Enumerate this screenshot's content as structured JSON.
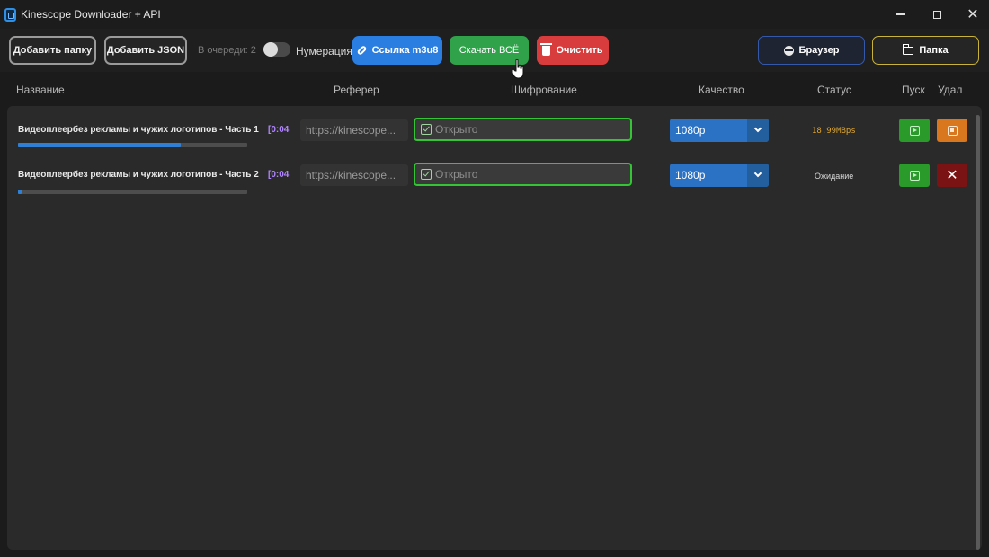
{
  "window": {
    "title": "Kinescope Downloader + API"
  },
  "toolbar": {
    "add_folder": "Добавить папку",
    "add_json": "Добавить JSON",
    "queue_label": "В очереди: 2",
    "numbering_label": "Нумерация",
    "numbering_on": false,
    "m3u8_link": "Ссылка m3u8",
    "download_all": "Скачать ВСЁ",
    "clear": "Очистить",
    "browser": "Браузер",
    "folder": "Папка"
  },
  "headers": {
    "name": "Название",
    "referer": "Реферер",
    "encryption": "Шифрование",
    "quality": "Качество",
    "status": "Статус",
    "start": "Пуск",
    "delete": "Удал"
  },
  "rows": [
    {
      "name": "Видеоплеербез рекламы и чужих логотипов - Часть 1",
      "duration": "[0:04",
      "progress": 0.71,
      "referer": "https://kinescope...",
      "encryption": "Открыто",
      "quality": "1080p",
      "status": "18.99MBps",
      "delete_action": "stop"
    },
    {
      "name": "Видеоплеербез рекламы и чужих логотипов - Часть 2",
      "duration": "[0:04",
      "progress": 0.01,
      "referer": "https://kinescope...",
      "encryption": "Открыто",
      "quality": "1080p",
      "status": "Ожидание",
      "delete_action": "remove"
    }
  ],
  "colors": {
    "accent_blue": "#2a7de1",
    "download_green": "#2fa24a",
    "clear_red": "#d93c3c",
    "encryption_border": "#35c435",
    "speed_status": "#e0a52c",
    "duration_purple": "#b084ff"
  },
  "icons": {
    "m3u8": "link-icon",
    "clear": "trash-icon",
    "browser": "globe-icon",
    "folder": "folder-icon",
    "play": "play-icon",
    "stop": "stop-icon",
    "remove": "close-icon"
  }
}
